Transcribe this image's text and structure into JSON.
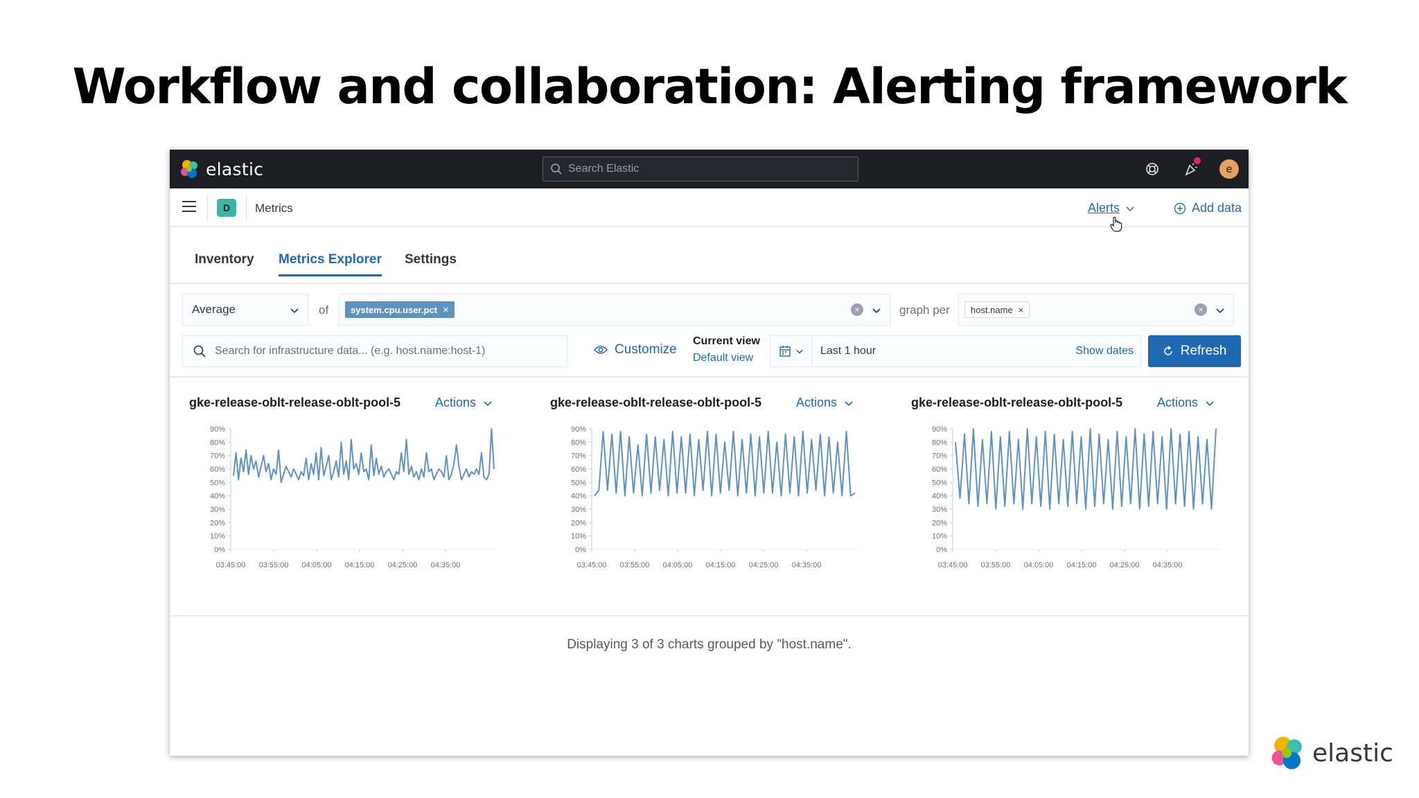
{
  "slide": {
    "title": "Workflow and collaboration: Alerting framework"
  },
  "topbar": {
    "brand": "elastic",
    "search_placeholder": "Search Elastic",
    "avatar_initial": "e"
  },
  "subbar": {
    "space_initial": "D",
    "breadcrumb": "Metrics",
    "alerts_label": "Alerts",
    "add_data_label": "Add data"
  },
  "tabs": [
    {
      "label": "Inventory",
      "active": false
    },
    {
      "label": "Metrics Explorer",
      "active": true
    },
    {
      "label": "Settings",
      "active": false
    }
  ],
  "filters": {
    "aggregation": "Average",
    "of_label": "of",
    "metric_pill": "system.cpu.user.pct",
    "graph_per_label": "graph per",
    "group_pill": "host.name",
    "search_placeholder": "Search for infrastructure data... (e.g. host.name:host-1)",
    "customize_label": "Customize",
    "current_view_label": "Current view",
    "default_view_label": "Default view",
    "time_range": "Last 1 hour",
    "show_dates_label": "Show dates",
    "refresh_label": "Refresh"
  },
  "charts": [
    {
      "title": "gke-release-oblt-release-oblt-pool-5",
      "actions_label": "Actions"
    },
    {
      "title": "gke-release-oblt-release-oblt-pool-5",
      "actions_label": "Actions"
    },
    {
      "title": "gke-release-oblt-release-oblt-pool-5",
      "actions_label": "Actions"
    }
  ],
  "chart_data": [
    {
      "type": "line",
      "x_ticks": [
        "03:45:00",
        "03:55:00",
        "04:05:00",
        "04:15:00",
        "04:25:00",
        "04:35:00"
      ],
      "y_ticks": [
        "0%",
        "10%",
        "20%",
        "30%",
        "40%",
        "50%",
        "60%",
        "70%",
        "80%",
        "90%"
      ],
      "ylim": [
        0,
        90
      ],
      "series": [
        {
          "values": [
            55,
            72,
            52,
            68,
            58,
            74,
            56,
            70,
            60,
            66,
            54,
            62,
            70,
            58,
            64,
            52,
            60,
            56,
            74,
            50,
            56,
            62,
            58,
            54,
            60,
            56,
            52,
            58,
            55,
            68,
            52,
            64,
            56,
            72,
            52,
            76,
            55,
            62,
            70,
            52,
            58,
            66,
            54,
            80,
            56,
            66,
            52,
            82,
            60,
            64,
            56,
            72,
            58,
            60,
            52,
            78,
            55,
            68,
            56,
            62,
            54,
            58,
            60,
            56,
            52,
            58,
            56,
            72,
            58,
            82,
            56,
            62,
            54,
            58,
            52,
            60,
            54,
            72,
            58,
            60,
            52,
            56,
            60,
            58,
            54,
            70,
            52,
            56,
            64,
            78,
            62,
            52,
            56,
            60,
            54,
            58,
            56,
            60,
            56,
            72,
            54,
            52,
            56,
            90,
            60
          ]
        }
      ]
    },
    {
      "type": "line",
      "x_ticks": [
        "03:45:00",
        "03:55:00",
        "04:05:00",
        "04:15:00",
        "04:25:00",
        "04:35:00"
      ],
      "y_ticks": [
        "0%",
        "10%",
        "20%",
        "30%",
        "40%",
        "50%",
        "60%",
        "70%",
        "80%",
        "90%"
      ],
      "ylim": [
        0,
        90
      ],
      "series": [
        {
          "values": [
            40,
            44,
            88,
            44,
            86,
            42,
            88,
            40,
            84,
            42,
            78,
            40,
            86,
            42,
            84,
            44,
            82,
            40,
            88,
            42,
            84,
            42,
            86,
            40,
            82,
            44,
            88,
            40,
            86,
            42,
            80,
            44,
            88,
            40,
            82,
            42,
            86,
            40,
            84,
            42,
            88,
            42,
            80,
            40,
            86,
            42,
            84,
            40,
            88,
            42,
            82,
            44,
            86,
            40,
            84,
            42,
            80,
            40,
            88,
            40,
            42
          ]
        }
      ]
    },
    {
      "type": "line",
      "x_ticks": [
        "03:45:00",
        "03:55:00",
        "04:05:00",
        "04:15:00",
        "04:25:00",
        "04:35:00"
      ],
      "y_ticks": [
        "0%",
        "10%",
        "20%",
        "30%",
        "40%",
        "50%",
        "60%",
        "70%",
        "80%",
        "90%"
      ],
      "ylim": [
        0,
        90
      ],
      "series": [
        {
          "values": [
            80,
            38,
            86,
            34,
            90,
            32,
            82,
            34,
            88,
            30,
            84,
            32,
            88,
            34,
            82,
            30,
            90,
            34,
            84,
            32,
            88,
            30,
            86,
            34,
            82,
            32,
            88,
            34,
            84,
            30,
            90,
            32,
            86,
            34,
            82,
            30,
            88,
            32,
            84,
            34,
            90,
            30,
            86,
            32,
            88,
            34,
            84,
            30,
            90,
            34,
            86,
            32,
            88,
            30,
            84,
            34,
            82,
            30,
            90
          ]
        }
      ]
    }
  ],
  "footer_note": "Displaying 3 of 3 charts grouped by \"host.name\".",
  "corner_brand": "elastic"
}
